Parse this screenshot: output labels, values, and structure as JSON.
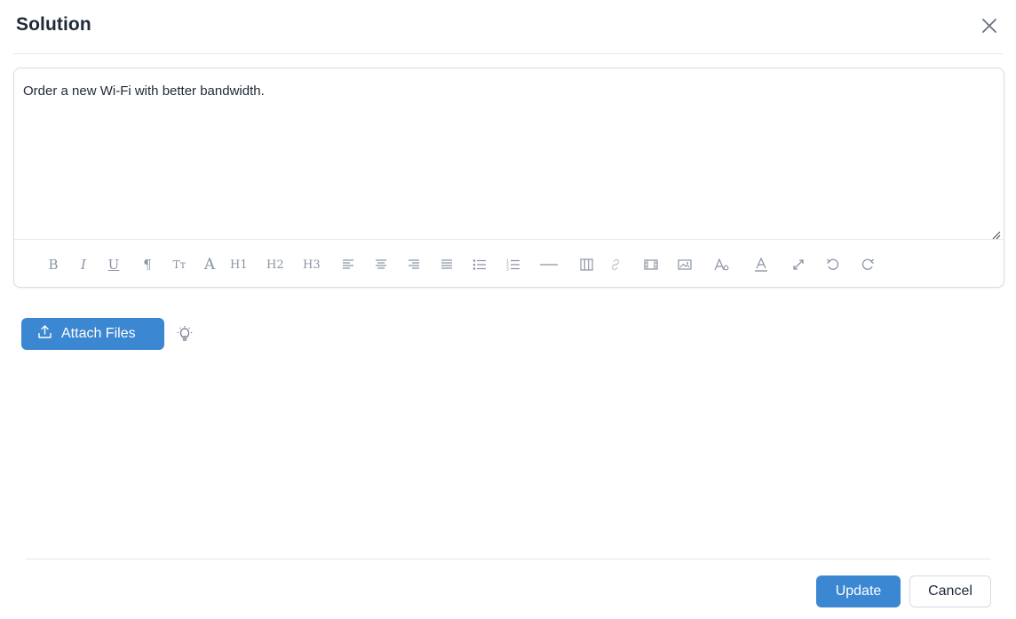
{
  "dialog": {
    "title": "Solution"
  },
  "editor": {
    "content": "Order a new Wi-Fi with better bandwidth.",
    "toolbar": {
      "bold": "B",
      "italic": "I",
      "underline": "U",
      "paragraph": "¶",
      "font_size": "Tт",
      "font_family": "A",
      "h1": "H1",
      "h2": "H2",
      "h3": "H3"
    }
  },
  "attach": {
    "label": "Attach Files"
  },
  "footer": {
    "update_label": "Update",
    "cancel_label": "Cancel"
  },
  "colors": {
    "primary": "#3b87d2",
    "icon": "#8a94a3",
    "border": "#d9dde3"
  }
}
